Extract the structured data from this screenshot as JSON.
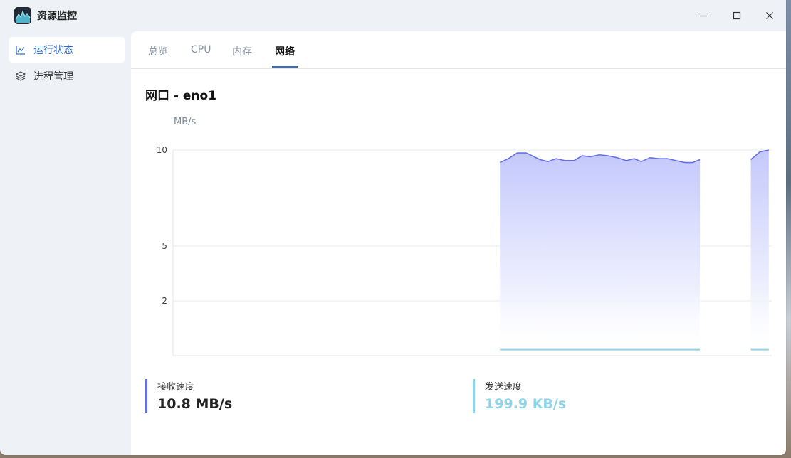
{
  "app": {
    "title": "资源监控"
  },
  "sidebar": {
    "items": [
      {
        "label": "运行状态",
        "active": true,
        "icon": "line-chart-icon"
      },
      {
        "label": "进程管理",
        "active": false,
        "icon": "layers-icon"
      }
    ]
  },
  "tabs": [
    {
      "label": "总览"
    },
    {
      "label": "CPU"
    },
    {
      "label": "内存"
    },
    {
      "label": "网络",
      "active": true
    }
  ],
  "section": {
    "title": "网口 - eno1"
  },
  "colors": {
    "accent": "#2f6fd1",
    "receive": "#6670e6",
    "send": "#8fd3e8"
  },
  "chart_data": {
    "type": "area",
    "ylabel": "MB/s",
    "yticks": [
      10,
      5,
      2
    ],
    "ylim": [
      0,
      10
    ],
    "series": [
      {
        "name": "接收速度",
        "segments": [
          [
            [
              0.546,
              9.35
            ],
            [
              0.56,
              9.55
            ],
            [
              0.575,
              9.85
            ],
            [
              0.59,
              9.85
            ],
            [
              0.6,
              9.7
            ],
            [
              0.613,
              9.5
            ],
            [
              0.626,
              9.4
            ],
            [
              0.64,
              9.55
            ],
            [
              0.655,
              9.45
            ],
            [
              0.67,
              9.45
            ],
            [
              0.683,
              9.7
            ],
            [
              0.697,
              9.65
            ],
            [
              0.712,
              9.75
            ],
            [
              0.727,
              9.7
            ],
            [
              0.742,
              9.6
            ],
            [
              0.757,
              9.45
            ],
            [
              0.77,
              9.55
            ],
            [
              0.782,
              9.4
            ],
            [
              0.797,
              9.6
            ],
            [
              0.812,
              9.55
            ],
            [
              0.826,
              9.55
            ],
            [
              0.84,
              9.45
            ],
            [
              0.855,
              9.35
            ],
            [
              0.868,
              9.35
            ],
            [
              0.88,
              9.5
            ]
          ],
          [
            [
              0.965,
              9.5
            ],
            [
              0.98,
              9.9
            ],
            [
              0.995,
              10.0
            ]
          ]
        ]
      },
      {
        "name": "发送速度",
        "segments": [
          [
            [
              0.546,
              0.14
            ],
            [
              0.88,
              0.14
            ]
          ],
          [
            [
              0.965,
              0.14
            ],
            [
              0.995,
              0.14
            ]
          ]
        ]
      }
    ]
  },
  "stats": {
    "receive": {
      "label": "接收速度",
      "value": "10.8 MB/s"
    },
    "send": {
      "label": "发送速度",
      "value": "199.9 KB/s"
    }
  }
}
